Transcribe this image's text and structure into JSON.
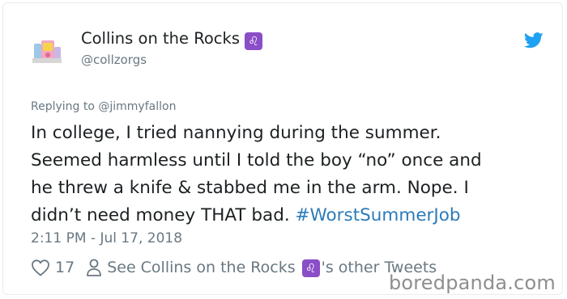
{
  "author": {
    "display_name": "Collins on the Rocks",
    "badge_glyph": "♌",
    "handle": "@collzorgs"
  },
  "tweet": {
    "reply_to": "Replying to @jimmyfallon",
    "lines": [
      "In college, I tried nannying during the summer.",
      "Seemed harmless until I told the boy “no” once and",
      "he threw a knife & stabbed me in the arm. Nope. I"
    ],
    "last_line_text": "didn’t need money THAT bad. ",
    "hashtag": "#WorstSummerJob",
    "timestamp": "2:11 PM - Jul 17, 2018"
  },
  "actions": {
    "like_count": "17",
    "see_other_prefix": "See Collins on the Rocks",
    "see_other_suffix": "'s other Tweets"
  },
  "watermark": "boredpanda.com",
  "colors": {
    "link": "#2b7bb9",
    "muted": "#697882",
    "text": "#1c2022",
    "badge": "#8a4ec7",
    "twitter_blue": "#1da1f2"
  },
  "icons": {
    "brand": "twitter-bird-icon",
    "like": "heart-icon",
    "profile": "person-icon",
    "zodiac": "leo-icon"
  }
}
